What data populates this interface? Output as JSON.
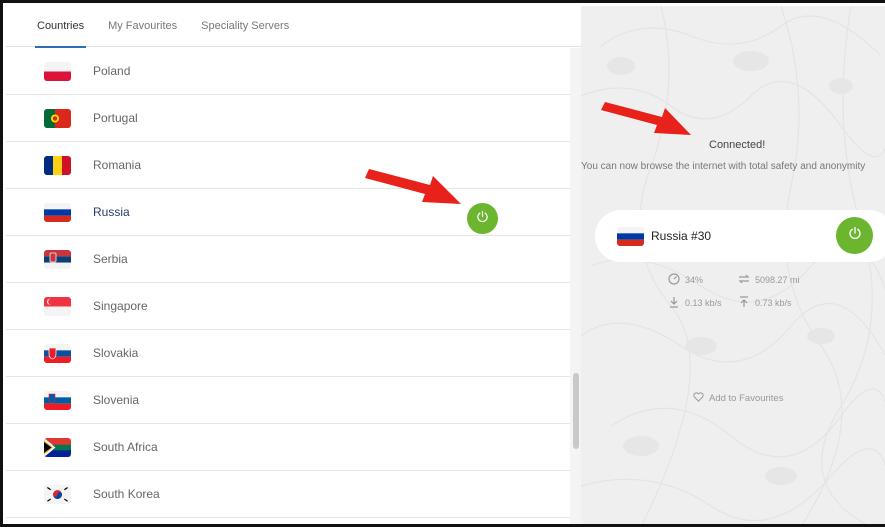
{
  "tabs": [
    {
      "label": "Countries",
      "active": true
    },
    {
      "label": "My Favourites",
      "active": false
    },
    {
      "label": "Speciality Servers",
      "active": false
    }
  ],
  "countries": [
    {
      "name": "Poland",
      "flag": "poland-flag-icon"
    },
    {
      "name": "Portugal",
      "flag": "portugal-flag-icon"
    },
    {
      "name": "Romania",
      "flag": "romania-flag-icon"
    },
    {
      "name": "Russia",
      "flag": "russia-flag-icon",
      "selected": true
    },
    {
      "name": "Serbia",
      "flag": "serbia-flag-icon"
    },
    {
      "name": "Singapore",
      "flag": "singapore-flag-icon"
    },
    {
      "name": "Slovakia",
      "flag": "slovakia-flag-icon"
    },
    {
      "name": "Slovenia",
      "flag": "slovenia-flag-icon"
    },
    {
      "name": "South Africa",
      "flag": "south-africa-flag-icon"
    },
    {
      "name": "South Korea",
      "flag": "south-korea-flag-icon"
    }
  ],
  "status": {
    "title": "Connected!",
    "description": "You can now browse the internet with total safety and anonymity"
  },
  "server": {
    "name": "Russia #30",
    "flag": "russia-flag-icon"
  },
  "stats": {
    "load": "34%",
    "distance": "5098.27 mi",
    "download": "0.13 kb/s",
    "upload": "0.73 kb/s"
  },
  "favourites_label": "Add to Favourites",
  "colors": {
    "power_green": "#6bb52f",
    "arrow_red": "#e8211b",
    "tab_underline": "#2f6fb0"
  }
}
